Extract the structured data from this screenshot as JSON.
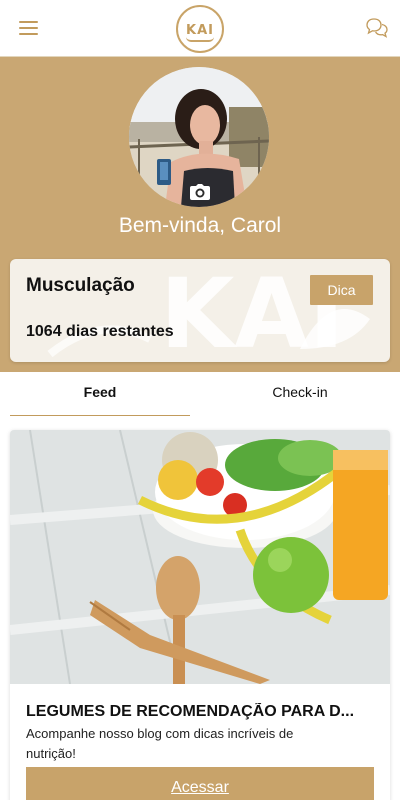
{
  "header": {
    "menu_icon": "hamburger-menu-icon",
    "logo_text": "KAI",
    "chat_icon": "chat-bubbles-icon",
    "accent_color": "#c29b5c"
  },
  "profile": {
    "welcome": "Bem-vinda, Carol",
    "camera_icon": "camera-icon",
    "background_color": "#c9a773"
  },
  "plan": {
    "title": "Musculação",
    "days_remaining": "1064 dias restantes",
    "tip_label": "Dica",
    "watermark_text": "KAI"
  },
  "tabs": [
    {
      "label": "Feed",
      "active": true
    },
    {
      "label": "Check-in",
      "active": false
    }
  ],
  "feed": {
    "items": [
      {
        "title": "LEGUMES DE RECOMENDAÇÃO PARA D...",
        "description": "Acompanhe nosso blog com dicas incríveis de nutrição!",
        "button_label": "Acessar"
      }
    ]
  }
}
